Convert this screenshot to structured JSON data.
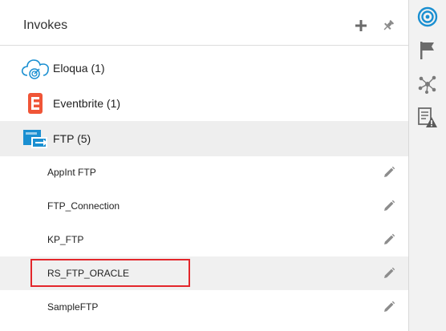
{
  "panel": {
    "title": "Invokes"
  },
  "connections": [
    {
      "label": "Eloqua (1)",
      "icon": "eloqua-cloud-icon"
    },
    {
      "label": "Eventbrite (1)",
      "icon": "eventbrite-icon"
    },
    {
      "label": "FTP (5)",
      "icon": "ftp-icon"
    }
  ],
  "ftp_items": [
    "AppInt FTP",
    "FTP_Connection",
    "KP_FTP",
    "RS_FTP_ORACLE",
    "SampleFTP"
  ],
  "colors": {
    "accent": "#1a8fd1",
    "eventbrite": "#f05537",
    "highlight": "#e3262b"
  }
}
